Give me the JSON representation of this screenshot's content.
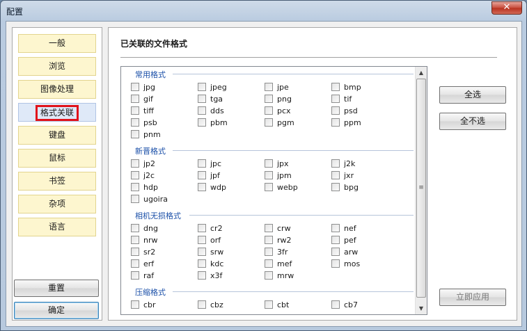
{
  "window": {
    "title": "配置",
    "close_glyph": "✕"
  },
  "nav": {
    "items": [
      "一般",
      "浏览",
      "图像处理",
      "格式关联",
      "键盘",
      "鼠标",
      "书签",
      "杂项",
      "语言"
    ],
    "active_index": 3
  },
  "buttons": {
    "reset": "重置",
    "ok": "确定",
    "select_all": "全选",
    "select_none": "全不选",
    "apply_now": "立即应用"
  },
  "content": {
    "heading": "已关联的文件格式",
    "groups": [
      {
        "title": "常用格式",
        "formats": [
          "jpg",
          "jpeg",
          "jpe",
          "bmp",
          "gif",
          "tga",
          "png",
          "tif",
          "tiff",
          "dds",
          "pcx",
          "psd",
          "psb",
          "pbm",
          "pgm",
          "ppm",
          "pnm"
        ]
      },
      {
        "title": "新晋格式",
        "formats": [
          "jp2",
          "jpc",
          "jpx",
          "j2k",
          "j2c",
          "jpf",
          "jpm",
          "jxr",
          "hdp",
          "wdp",
          "webp",
          "bpg",
          "ugoira"
        ]
      },
      {
        "title": "相机无损格式",
        "formats": [
          "dng",
          "cr2",
          "crw",
          "nef",
          "nrw",
          "orf",
          "rw2",
          "pef",
          "sr2",
          "srw",
          "3fr",
          "arw",
          "erf",
          "kdc",
          "mef",
          "mos",
          "raf",
          "x3f",
          "mrw"
        ]
      },
      {
        "title": "压缩格式",
        "formats": [
          "cbr",
          "cbz",
          "cbt",
          "cb7"
        ]
      }
    ]
  },
  "scrollbar": {
    "up_glyph": "▲",
    "down_glyph": "▼",
    "grip_glyph": "≡"
  },
  "colors": {
    "highlight_border": "#e1131b",
    "group_title": "#1a4fa8",
    "nav_item_bg": "#fdf6cf"
  }
}
